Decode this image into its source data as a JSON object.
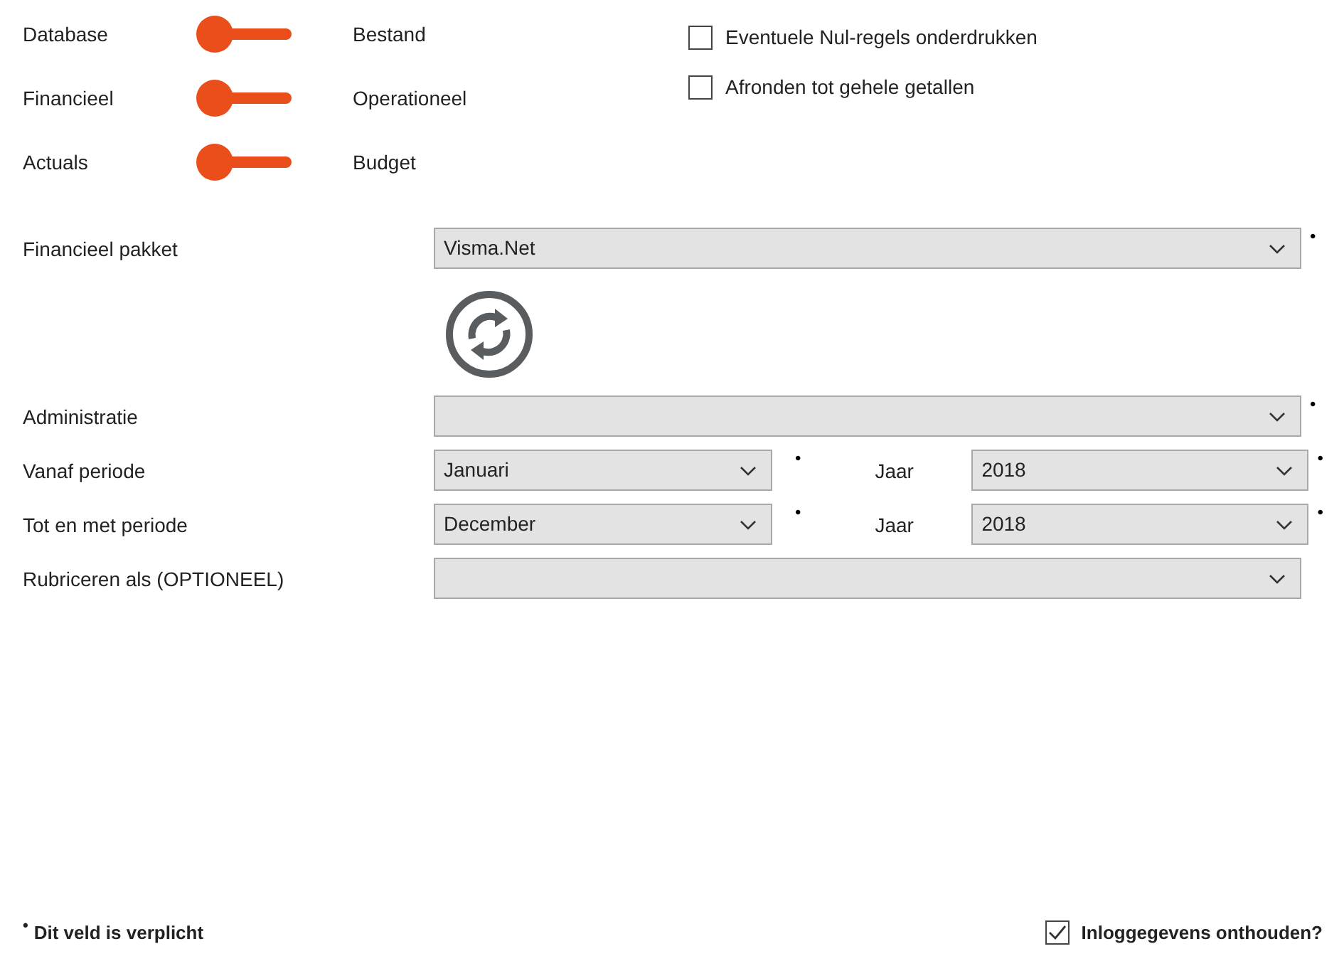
{
  "toggles": [
    {
      "left_label": "Database",
      "right_label": "Bestand",
      "on": false
    },
    {
      "left_label": "Financieel",
      "right_label": "Operationeel",
      "on": false
    },
    {
      "left_label": "Actuals",
      "right_label": "Budget",
      "on": false
    }
  ],
  "options": [
    {
      "label": "Eventuele Nul-regels onderdrukken",
      "checked": false
    },
    {
      "label": "Afronden tot gehele getallen",
      "checked": false
    }
  ],
  "package": {
    "label": "Financieel pakket",
    "value": "Visma.Net",
    "required_mark": "•"
  },
  "fields": [
    {
      "kind": "full",
      "label": "Administratie",
      "required_mark": "•"
    },
    {
      "kind": "split",
      "label": "Vanaf periode",
      "value": "Januari",
      "required_mark": "•",
      "year_label": "Jaar",
      "year_value": "2018",
      "year_required_mark": "•"
    },
    {
      "kind": "split",
      "label": "Tot en met periode",
      "value": "December",
      "required_mark": "•",
      "year_label": "Jaar",
      "year_value": "2018",
      "year_required_mark": "•"
    },
    {
      "kind": "full",
      "label": "Rubriceren als (OPTIONEEL)"
    }
  ],
  "footer": {
    "mark": "•",
    "note": "Dit veld is verplicht",
    "remember": {
      "label": "Inloggegevens onthouden?",
      "checked": true
    }
  }
}
